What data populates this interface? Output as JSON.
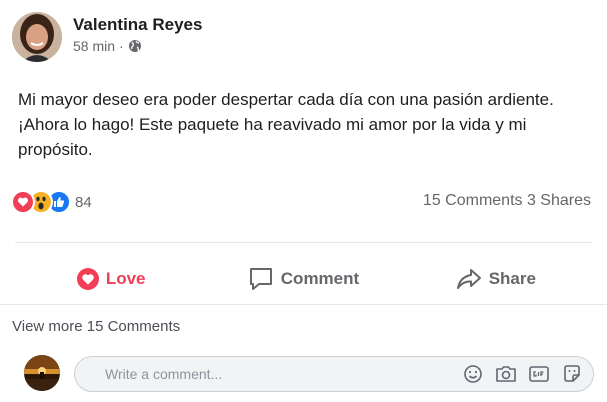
{
  "post": {
    "author": "Valentina Reyes",
    "time": "58 min",
    "separator": "·",
    "privacy_icon": "globe-icon",
    "text": "Mi mayor deseo era poder despertar cada día con una pasión ardiente. ¡Ahora lo hago! Este paquete ha reavivado mi amor por la vida y mi propósito."
  },
  "reactions": {
    "icons": [
      "love-reaction-icon",
      "wow-reaction-icon",
      "like-reaction-icon"
    ],
    "count": "84",
    "comments_shares": "15 Comments 3 Shares"
  },
  "actions": {
    "love": "Love",
    "comment": "Comment",
    "share": "Share"
  },
  "comments": {
    "view_more": "View more 15 Comments",
    "input_placeholder": "Write a comment...",
    "input_icons": [
      "emoji-icon",
      "camera-icon",
      "gif-icon",
      "sticker-icon"
    ]
  },
  "colors": {
    "love": "#f33e58",
    "like": "#1877f2",
    "wow": "#f7b125",
    "secondary_text": "#65676b"
  }
}
